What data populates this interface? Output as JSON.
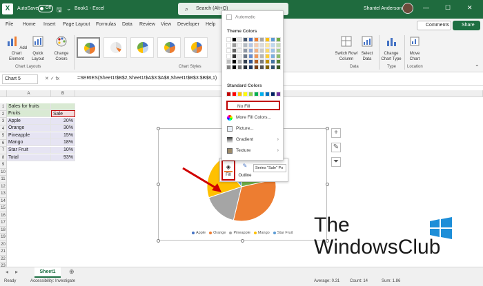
{
  "titlebar": {
    "autosave_label": "AutoSave",
    "autosave_state": "Off",
    "doc_title": "Book1 - Excel",
    "search_placeholder": "Search (Alt+Q)",
    "user_name": "Shantel Anderson"
  },
  "menu": {
    "tabs": [
      "File",
      "Home",
      "Insert",
      "Page Layout",
      "Formulas",
      "Data",
      "Review",
      "View",
      "Developer",
      "Help"
    ],
    "comments": "Comments",
    "share": "Share"
  },
  "ribbon": {
    "add_chart_element": "Add Chart Element",
    "quick_layout": "Quick Layout",
    "change_colors": "Change Colors",
    "chart_layouts_label": "Chart Layouts",
    "chart_styles_label": "Chart Styles",
    "switch_row_col": "Switch Row/ Column",
    "select_data": "Select Data",
    "change_chart_type": "Change Chart Type",
    "move_chart": "Move Chart",
    "data_label": "Data",
    "type_label": "Type",
    "location_label": "Location"
  },
  "formula_bar": {
    "name_box": "Chart 5",
    "formula": "=SERIES(Sheet1!$B$2,Sheet1!$A$3:$A$8,Sheet1!$B$3:$B$8,1)"
  },
  "sheet": {
    "columns": [
      "A",
      "B"
    ],
    "rows": [
      [
        "Sales  for fruits",
        ""
      ],
      [
        "Fruits",
        "Sale"
      ],
      [
        "Apple",
        "20%"
      ],
      [
        "Orange",
        "30%"
      ],
      [
        "Pineapple",
        "15%"
      ],
      [
        "Mango",
        "18%"
      ],
      [
        "Star Fruit",
        "10%"
      ],
      [
        "Total",
        "93%"
      ]
    ],
    "row_numbers": [
      "1",
      "2",
      "3",
      "4",
      "5",
      "6",
      "7",
      "8",
      "9",
      "10",
      "11",
      "12",
      "13",
      "14",
      "15",
      "16",
      "17",
      "18",
      "19",
      "20",
      "21",
      "22",
      "23"
    ]
  },
  "chart_data": {
    "type": "pie",
    "categories": [
      "Apple",
      "Orange",
      "Pineapple",
      "Mango",
      "Star Fruit"
    ],
    "values": [
      20,
      30,
      15,
      18,
      10
    ],
    "colors": [
      "#4472c4",
      "#ed7d31",
      "#a5a5a5",
      "#ffc000",
      "#5b9bd5"
    ],
    "title": "",
    "legend": "bottom"
  },
  "mini_toolbar": {
    "fill": "Fill",
    "outline": "Outline",
    "series": "Series \"Sale\" Po"
  },
  "dropdown": {
    "automatic": "Automatic",
    "theme_colors_label": "Theme Colors",
    "standard_colors_label": "Standard Colors",
    "no_fill": "No Fill",
    "more_fill_colors": "More Fill Colors...",
    "picture": "Picture...",
    "gradient": "Gradient",
    "texture": "Texture",
    "theme_top_row": [
      "#ffffff",
      "#000000",
      "#e7e6e6",
      "#44546a",
      "#4472c4",
      "#ed7d31",
      "#a5a5a5",
      "#ffc000",
      "#5b9bd5",
      "#70ad47"
    ],
    "standard_colors": [
      "#c00000",
      "#ff0000",
      "#ffc000",
      "#ffff00",
      "#92d050",
      "#00b050",
      "#00b0f0",
      "#0070c0",
      "#002060",
      "#7030a0"
    ]
  },
  "watermark": {
    "line1": "The",
    "line2": "WindowsClub"
  },
  "bottom": {
    "sheet_tab": "Sheet1",
    "ready": "Ready",
    "accessibility": "Accessibility: Investigate",
    "average": "Average: 0.31",
    "count": "Count: 14",
    "sum": "Sum: 1.86"
  }
}
